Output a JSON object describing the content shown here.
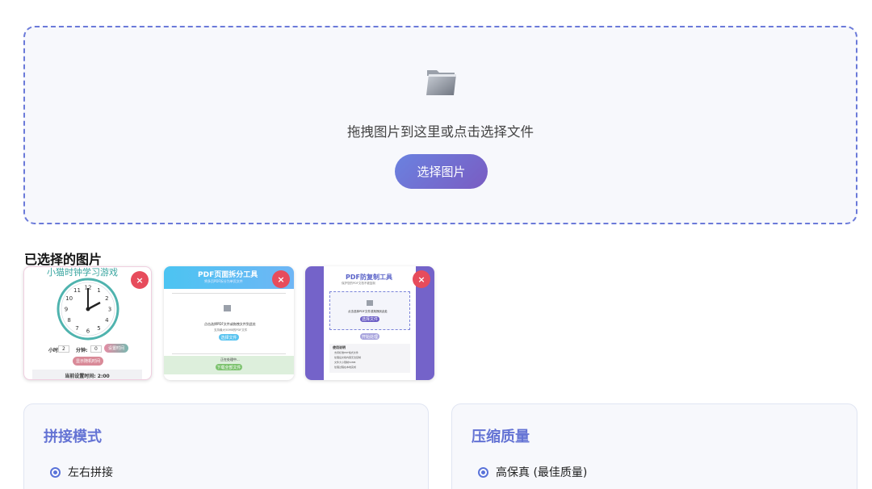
{
  "dropzone": {
    "icon": "folder-icon",
    "text": "拖拽图片到这里或点击选择文件",
    "button_label": "选择图片"
  },
  "selected": {
    "title": "已选择的图片",
    "remove_label": "×",
    "thumbnails": [
      {
        "title": "小猫时钟学习游戏",
        "hour_label": "小时:",
        "hour_value": "2",
        "minute_label": "分钟:",
        "minute_value": "0",
        "set_button": "设置时间",
        "random_button": "显示随机时间",
        "current_time": "当前设置时间: 2:00",
        "clock_numbers": [
          "12",
          "1",
          "2",
          "3",
          "4",
          "5",
          "6",
          "7",
          "8",
          "9",
          "10",
          "11"
        ]
      },
      {
        "title": "PDF页面拆分工具",
        "subtitle": "将多页PDF拆分为单页文件",
        "drop_text": "点击选择PDF文件或拖拽文件到此处",
        "hint": "支持最大50MB的PDF文件",
        "button": "选择文件",
        "status": "正在处理中...",
        "download_button": "下载全部文件"
      },
      {
        "title": "PDF防复制工具",
        "subtitle": "保护您的PDF文档不被复制",
        "drop_text": "点击选择PDF文件或拖拽到此处",
        "button": "选择文件",
        "process_button": "开始处理",
        "notes_title": "使用说明",
        "notes": [
          "支持标准PDF格式文件",
          "处理后文档内容无法复制",
          "文件大小限制50MB",
          "处理过程在本地完成"
        ]
      }
    ]
  },
  "options": {
    "mode": {
      "title": "拼接模式",
      "selected_option": "左右拼接"
    },
    "quality": {
      "title": "压缩质量",
      "selected_option": "高保真 (最佳质量)"
    }
  },
  "colors": {
    "accent": "#6473d4",
    "button_gradient_start": "#6a82e0",
    "button_gradient_end": "#7a5cc2",
    "remove": "#e74c5c",
    "dash_border": "#6b7ad9"
  }
}
